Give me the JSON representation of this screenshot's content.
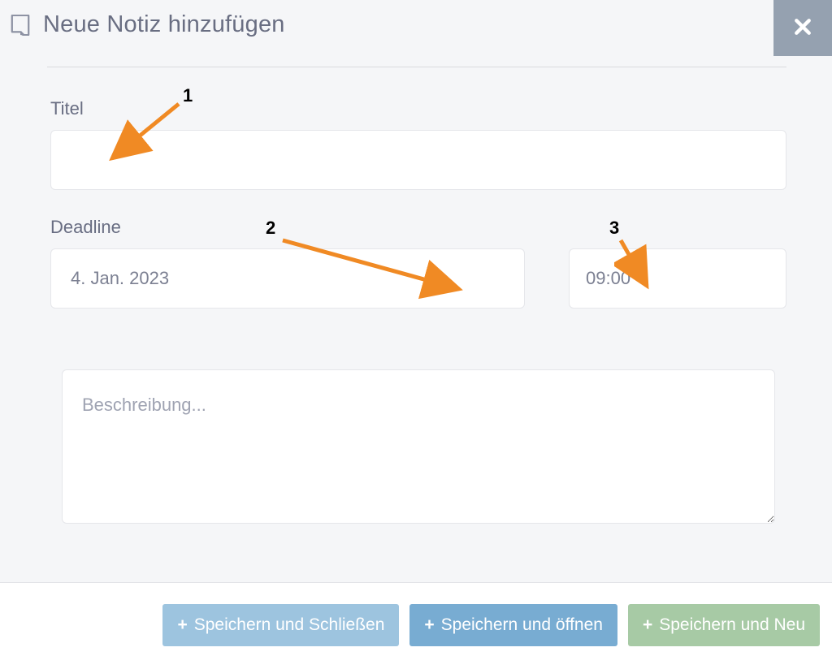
{
  "modal": {
    "title": "Neue Notiz hinzufügen"
  },
  "form": {
    "title_label": "Titel",
    "title_value": "",
    "deadline_label": "Deadline",
    "date_value": "4. Jan. 2023",
    "time_value": "09:00",
    "description_placeholder": "Beschreibung...",
    "description_value": ""
  },
  "buttons": {
    "save_close": "Speichern und Schließen",
    "save_open": "Speichern und öffnen",
    "save_new": "Speichern und Neu"
  },
  "annotations": {
    "num1": "1",
    "num2": "2",
    "num3": "3"
  }
}
